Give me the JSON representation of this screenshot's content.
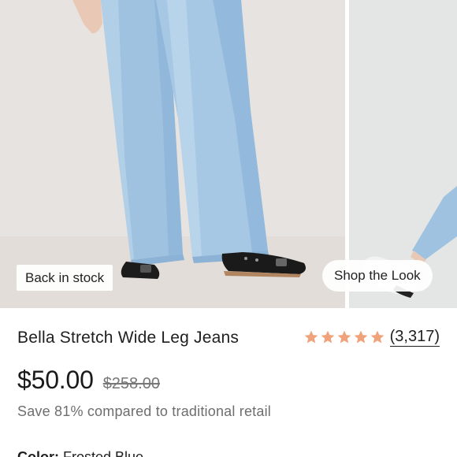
{
  "gallery": {
    "badge_stock": "Back in stock",
    "badge_look": "Shop the Look"
  },
  "product": {
    "title": "Bella Stretch Wide Leg Jeans",
    "rating_stars": 5,
    "star_color": "#f0a27a",
    "review_count": "(3,317)",
    "price": "$50.00",
    "original_price": "$258.00",
    "savings_text": "Save 81% compared to traditional retail",
    "color_label": "Color:",
    "color_value": "Frosted Blue"
  }
}
